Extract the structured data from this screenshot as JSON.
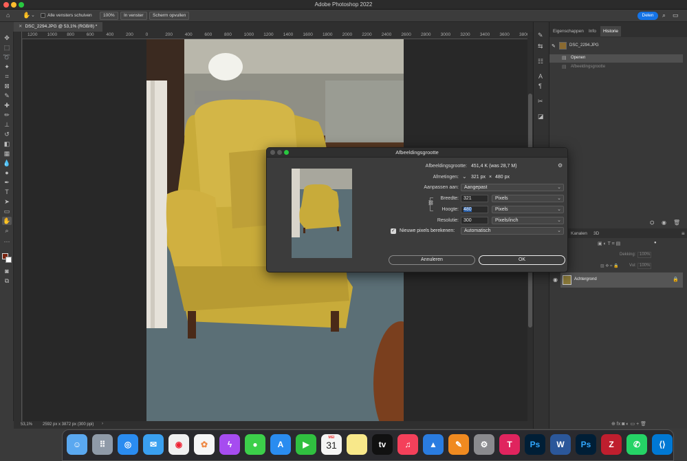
{
  "app": {
    "title": "Adobe Photoshop 2022"
  },
  "options_bar": {
    "all_windows_label": "Alle vensters schuiven",
    "zoom_100_label": "100%",
    "fit_window_label": "In venster",
    "fill_screen_label": "Scherm opvullen",
    "share_label": "Delen"
  },
  "document": {
    "tab_label": "DSC_2294.JPG @ 53,1% (RGB/8) *",
    "ruler_labels": [
      "1200",
      "1000",
      "800",
      "600",
      "400",
      "200",
      "0",
      "200",
      "400",
      "600",
      "800",
      "1000",
      "1200",
      "1400",
      "1600",
      "1800",
      "2000",
      "2200",
      "2400",
      "2600",
      "2800",
      "3000",
      "3200",
      "3400",
      "3600",
      "3800"
    ],
    "zoom_status": "53,1%",
    "size_status": "2592 px x 3872 px (300 ppi)"
  },
  "panels": {
    "tabs": [
      "Eigenschappen",
      "Info",
      "Historie"
    ],
    "history": {
      "snapshot": "DSC_2294.JPG",
      "items": [
        "Openen",
        "Afbeeldingsgrootte"
      ]
    },
    "layers_tabs": [
      "Kanalen",
      "3D"
    ],
    "opacity_label": "Dekking:",
    "opacity_value": "100%",
    "fill_label": "Vul:",
    "fill_value": "100%",
    "layer_name": "Achtergrond"
  },
  "dialog": {
    "title": "Afbeeldingsgrootte",
    "image_size_label": "Afbeeldingsgrootte:",
    "image_size_value": "451,4 K (was 28,7 M)",
    "dimensions_label": "Afmetingen:",
    "dimensions_w": "321 px",
    "dimensions_x": "×",
    "dimensions_h": "480 px",
    "fit_to_label": "Aanpassen aan:",
    "fit_to_value": "Aangepast",
    "width_label": "Breedte:",
    "width_value": "321",
    "width_unit": "Pixels",
    "height_label": "Hoogte:",
    "height_value": "480",
    "height_unit": "Pixels",
    "resolution_label": "Resolutie:",
    "resolution_value": "300",
    "resolution_unit": "Pixels/inch",
    "resample_label": "Nieuwe pixels berekenen:",
    "resample_value": "Automatisch",
    "cancel_label": "Annuleren",
    "ok_label": "OK"
  },
  "dock": {
    "calendar_month": "MEI",
    "calendar_day": "31"
  }
}
